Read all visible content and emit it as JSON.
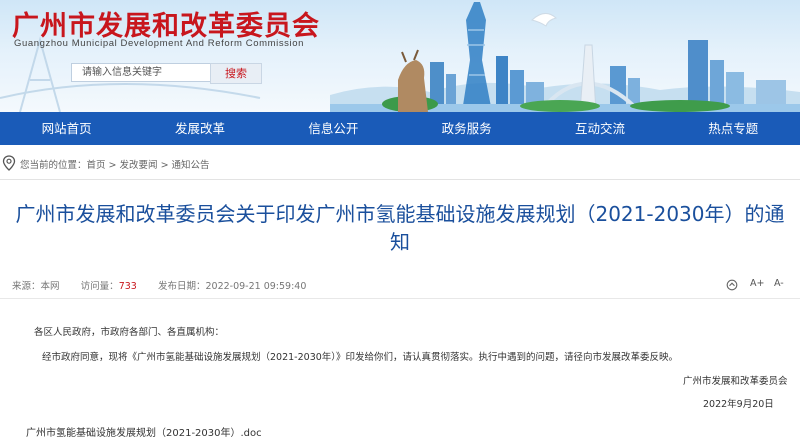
{
  "header": {
    "title": "广州市发展和改革委员会",
    "subtitle": "Guangzhou Municipal Development And Reform Commission"
  },
  "search": {
    "placeholder": "请输入信息关键字",
    "button_label": "搜索"
  },
  "nav": {
    "items": [
      "网站首页",
      "发展改革",
      "信息公开",
      "政务服务",
      "互动交流",
      "热点专题"
    ]
  },
  "breadcrumb": {
    "prefix": "您当前的位置：",
    "items": [
      "首页",
      "发改要闻",
      "通知公告"
    ],
    "separator": " > "
  },
  "article": {
    "title": "广州市发展和改革委员会关于印发广州市氢能基础设施发展规划（2021-2030年）的通知",
    "source_label": "来源：",
    "source_value": "本网",
    "views_label": "访问量：",
    "views_value": "733",
    "date_label": "发布日期：",
    "date_value": "2022-09-21 09:59:40",
    "greeting": "各区人民政府，市政府各部门、各直属机构：",
    "body": "经市政府同意，现将《广州市氢能基础设施发展规划（2021-2030年）》印发给你们，请认真贯彻落实。执行中遇到的问题，请径向市发展改革委反映。",
    "signature": "广州市发展和改革委员会",
    "sign_date": "2022年9月20日",
    "attachment": "广州市氢能基础设施发展规划（2021-2030年）.doc"
  },
  "tools": {
    "font_up": "A+",
    "font_down": "A-"
  },
  "colors": {
    "brand_red": "#c8161d",
    "nav_blue": "#1a5bb8",
    "title_blue": "#1a4f9c"
  }
}
